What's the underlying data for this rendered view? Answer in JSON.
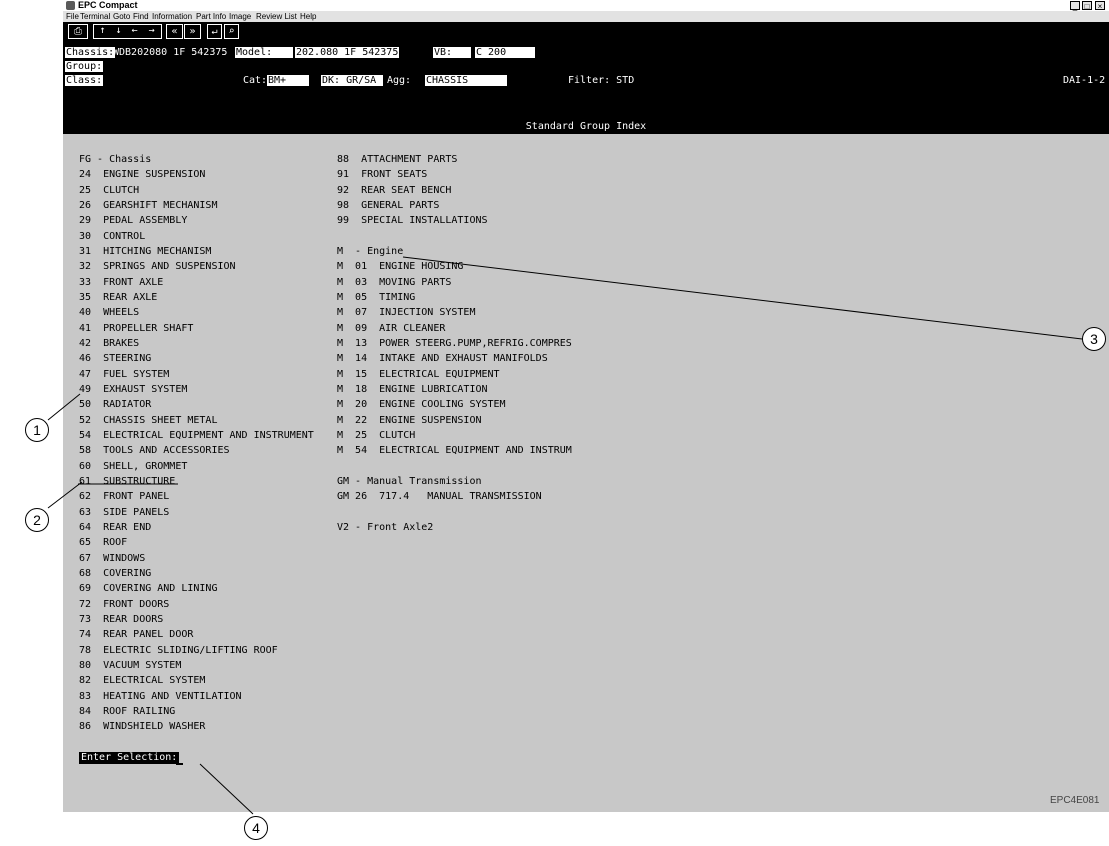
{
  "window": {
    "title": "EPC Compact",
    "min": "_",
    "max": "□",
    "close": "×"
  },
  "menu": [
    "File",
    "Terminal",
    "Goto",
    "Find",
    "Information",
    "Part Info",
    "Image",
    "Review List",
    "Help"
  ],
  "toolbar": {
    "print": "⎙",
    "arrow_up": "↑",
    "arrow_down": "↓",
    "arrow_left": "←",
    "arrow_right": "→",
    "page_back": "«",
    "page_fwd": "»",
    "enter": "↵",
    "search": "⌕"
  },
  "header": {
    "chassis_label": "Chassis:",
    "chassis_value": "WDB202080 1F 542375",
    "model_label": "Model:",
    "model_value": "202.080 1F 542375",
    "vb_label": "VB:",
    "vb_value": "C 200",
    "group_label": "Group:",
    "class_label": "Class:",
    "cat_label": "Cat:",
    "cat_value": "BM+",
    "dk_label": "DK: GR/SA",
    "agg_label": "Agg:",
    "agg_value": "CHASSIS",
    "filter_label": "Filter: STD",
    "dai": "DAI-1-2"
  },
  "section_title": "Standard Group Index",
  "left_list": [
    "FG - Chassis",
    "24  ENGINE SUSPENSION",
    "25  CLUTCH",
    "26  GEARSHIFT MECHANISM",
    "29  PEDAL ASSEMBLY",
    "30  CONTROL",
    "31  HITCHING MECHANISM",
    "32  SPRINGS AND SUSPENSION",
    "33  FRONT AXLE",
    "35  REAR AXLE",
    "40  WHEELS",
    "41  PROPELLER SHAFT",
    "42  BRAKES",
    "46  STEERING",
    "47  FUEL SYSTEM",
    "49  EXHAUST SYSTEM",
    "50  RADIATOR",
    "52  CHASSIS SHEET METAL",
    "54  ELECTRICAL EQUIPMENT AND INSTRUMENT",
    "58  TOOLS AND ACCESSORIES",
    "60  SHELL, GROMMET",
    "61  SUBSTRUCTURE",
    "62  FRONT PANEL",
    "63  SIDE PANELS",
    "64  REAR END",
    "65  ROOF",
    "67  WINDOWS",
    "68  COVERING",
    "69  COVERING AND LINING",
    "72  FRONT DOORS",
    "73  REAR DOORS",
    "74  REAR PANEL DOOR",
    "78  ELECTRIC SLIDING/LIFTING ROOF",
    "80  VACUUM SYSTEM",
    "82  ELECTRICAL SYSTEM",
    "83  HEATING AND VENTILATION",
    "84  ROOF RAILING",
    "86  WINDSHIELD WASHER"
  ],
  "right_list_a": [
    "88  ATTACHMENT PARTS",
    "91  FRONT SEATS",
    "92  REAR SEAT BENCH",
    "98  GENERAL PARTS",
    "99  SPECIAL INSTALLATIONS"
  ],
  "right_list_b": [
    "M  - Engine",
    "M  01  ENGINE HOUSING",
    "M  03  MOVING PARTS",
    "M  05  TIMING",
    "M  07  INJECTION SYSTEM",
    "M  09  AIR CLEANER",
    "M  13  POWER STEERG.PUMP,REFRIG.COMPRES",
    "M  14  INTAKE AND EXHAUST MANIFOLDS",
    "M  15  ELECTRICAL EQUIPMENT",
    "M  18  ENGINE LUBRICATION",
    "M  20  ENGINE COOLING SYSTEM",
    "M  22  ENGINE SUSPENSION",
    "M  25  CLUTCH",
    "M  54  ELECTRICAL EQUIPMENT AND INSTRUM"
  ],
  "right_list_c": [
    "GM - Manual Transmission",
    "GM 26  717.4   MANUAL TRANSMISSION"
  ],
  "right_list_d": [
    "V2 - Front Axle2"
  ],
  "prompt": "Enter Selection:",
  "figure_ref": "EPC4E081",
  "callouts": [
    "1",
    "2",
    "3",
    "4"
  ]
}
